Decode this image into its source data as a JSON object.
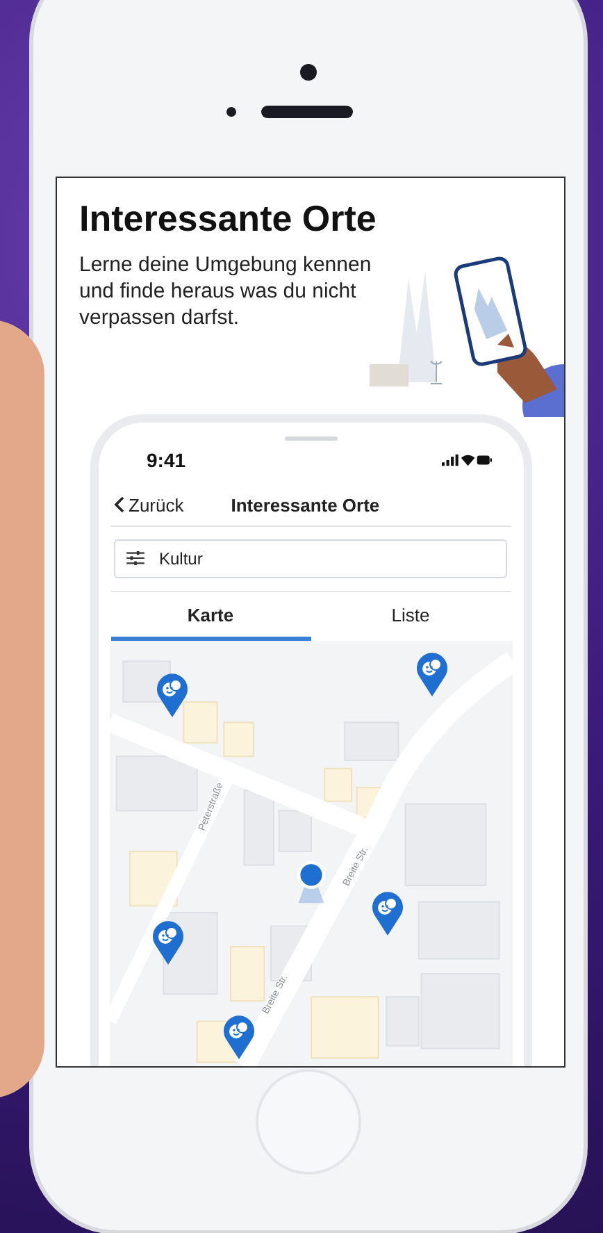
{
  "screen": {
    "title": "Interessante Orte",
    "description": "Lerne deine Umgebung kennen und finde heraus was du nicht verpassen darfst."
  },
  "app": {
    "status_time": "9:41",
    "back_label": "Zurück",
    "nav_title": "Interessante Orte",
    "filter": {
      "value": "Kultur"
    },
    "tabs": [
      {
        "label": "Karte",
        "selected": true
      },
      {
        "label": "Liste",
        "selected": false
      }
    ],
    "map": {
      "street_labels": [
        "Peterstraße",
        "Breite Str.",
        "Breite Str."
      ]
    }
  }
}
